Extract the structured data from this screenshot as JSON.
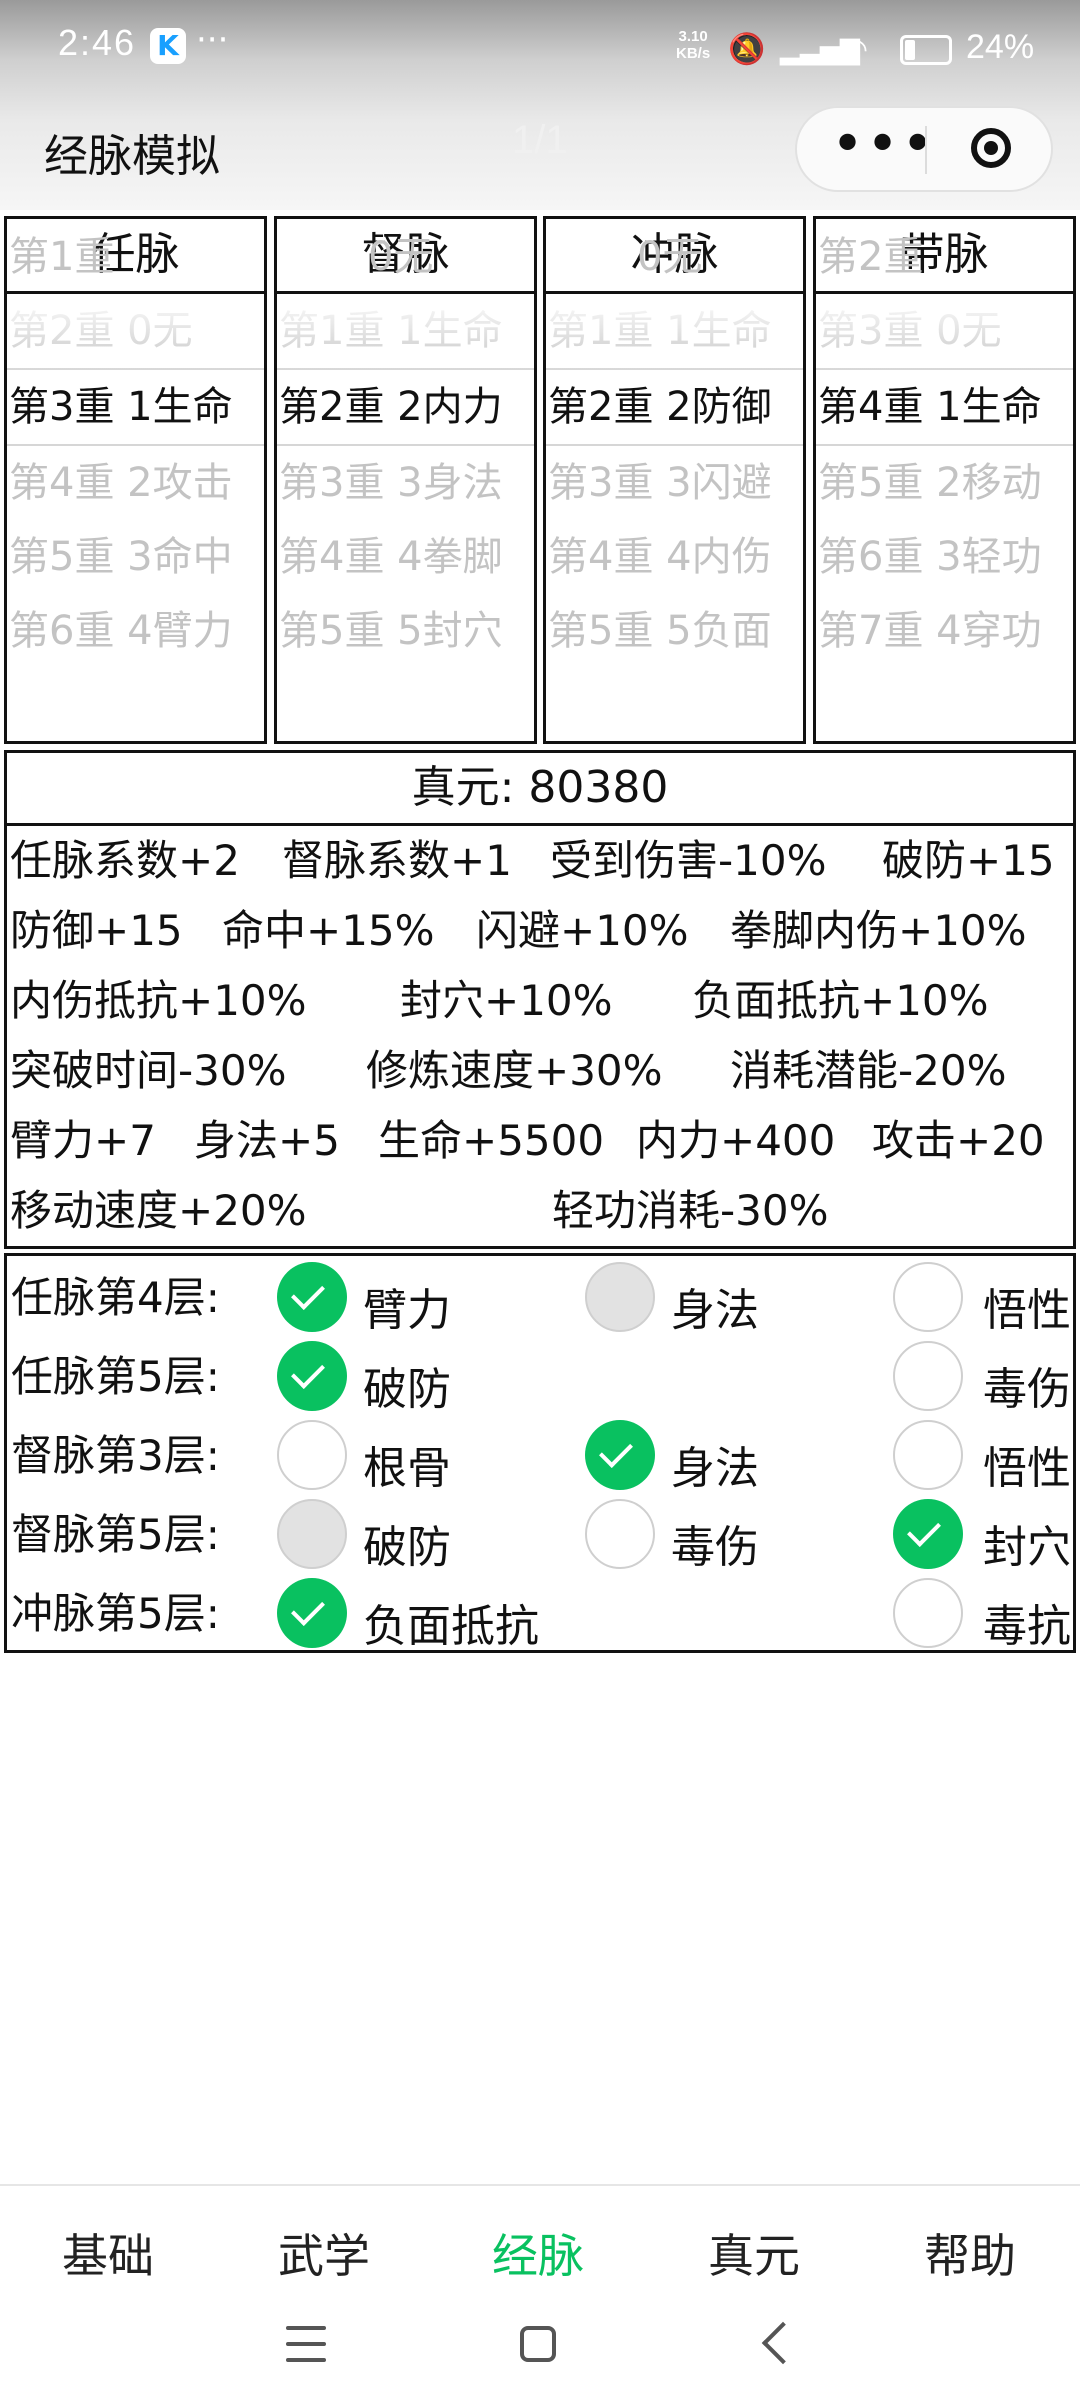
{
  "status": {
    "time": "2:46",
    "app_badge": "K",
    "more": "···",
    "net_rate_value": "3.10",
    "net_rate_unit": "KB/s",
    "battery_pct": "24%"
  },
  "header": {
    "title": "经脉模拟",
    "pager": "1/1"
  },
  "columns": [
    {
      "name": "任脉",
      "items": [
        "第1重",
        "第2重 0无",
        "第3重 1生命",
        "第4重 2攻击",
        "第5重 3命中",
        "第6重 4臂力"
      ],
      "selected_index": 2
    },
    {
      "name": "督脉",
      "items": [
        "       0无",
        "第1重 1生命",
        "第2重 2内力",
        "第3重 3身法",
        "第4重 4拳脚",
        "第5重 5封穴"
      ],
      "selected_index": 2
    },
    {
      "name": "冲脉",
      "items": [
        "       0无",
        "第1重 1生命",
        "第2重 2防御",
        "第3重 3闪避",
        "第4重 4内伤",
        "第5重 5负面"
      ],
      "selected_index": 2
    },
    {
      "name": "带脉",
      "items": [
        "第1重",
        "第2重",
        "第3重 0无",
        "第4重 1生命",
        "第5重 2移动",
        "第6重 3轻功",
        "第7重 4穿功"
      ],
      "selected_index": 3
    }
  ],
  "stats": {
    "zhenyuan_label": "真元:",
    "zhenyuan_value": "80380",
    "rows": [
      [
        "任脉系数+2",
        "督脉系数+1",
        "受到伤害-10%",
        "破防+15"
      ],
      [
        "防御+15",
        "命中+15%",
        "闪避+10%",
        "拳脚内伤+10%"
      ],
      [
        "内伤抵抗+10%",
        "封穴+10%",
        "负面抵抗+10%"
      ],
      [
        "突破时间-30%",
        "修炼速度+30%",
        "消耗潜能-20%"
      ],
      [
        "臂力+7",
        "身法+5",
        "生命+5500",
        "内力+400",
        "攻击+20"
      ],
      [
        "移动速度+20%",
        "轻功消耗-30%"
      ]
    ]
  },
  "options": [
    {
      "label": "任脉第4层:",
      "choices": [
        {
          "text": "臂力",
          "state": "checked"
        },
        {
          "text": "身法",
          "state": "disabled"
        },
        {
          "text": "悟性",
          "state": "unchecked"
        }
      ]
    },
    {
      "label": "任脉第5层:",
      "choices": [
        {
          "text": "破防",
          "state": "checked"
        },
        null,
        {
          "text": "毒伤",
          "state": "unchecked"
        }
      ]
    },
    {
      "label": "督脉第3层:",
      "choices": [
        {
          "text": "根骨",
          "state": "unchecked"
        },
        {
          "text": "身法",
          "state": "checked"
        },
        {
          "text": "悟性",
          "state": "unchecked"
        }
      ]
    },
    {
      "label": "督脉第5层:",
      "choices": [
        {
          "text": "破防",
          "state": "disabled"
        },
        {
          "text": "毒伤",
          "state": "unchecked"
        },
        {
          "text": "封穴",
          "state": "checked"
        }
      ]
    },
    {
      "label": "冲脉第5层:",
      "choices": [
        {
          "text": "负面抵抗",
          "state": "checked"
        },
        null,
        {
          "text": "毒抗",
          "state": "unchecked"
        }
      ]
    }
  ],
  "tabs": [
    {
      "label": "基础",
      "active": false
    },
    {
      "label": "武学",
      "active": false
    },
    {
      "label": "经脉",
      "active": true
    },
    {
      "label": "真元",
      "active": false
    },
    {
      "label": "帮助",
      "active": false
    }
  ],
  "colors": {
    "accent_green": "#09c160",
    "border": "#111111",
    "inactive_text": "#c3c3c3"
  }
}
